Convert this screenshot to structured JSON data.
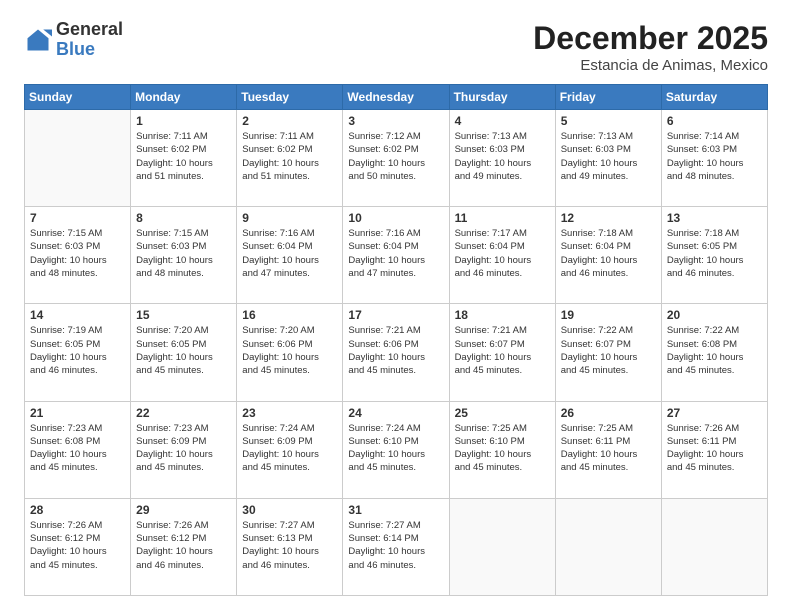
{
  "header": {
    "logo": {
      "general": "General",
      "blue": "Blue"
    },
    "month": "December 2025",
    "location": "Estancia de Animas, Mexico"
  },
  "days_of_week": [
    "Sunday",
    "Monday",
    "Tuesday",
    "Wednesday",
    "Thursday",
    "Friday",
    "Saturday"
  ],
  "weeks": [
    [
      {
        "day": "",
        "info": ""
      },
      {
        "day": "1",
        "info": "Sunrise: 7:11 AM\nSunset: 6:02 PM\nDaylight: 10 hours\nand 51 minutes."
      },
      {
        "day": "2",
        "info": "Sunrise: 7:11 AM\nSunset: 6:02 PM\nDaylight: 10 hours\nand 51 minutes."
      },
      {
        "day": "3",
        "info": "Sunrise: 7:12 AM\nSunset: 6:02 PM\nDaylight: 10 hours\nand 50 minutes."
      },
      {
        "day": "4",
        "info": "Sunrise: 7:13 AM\nSunset: 6:03 PM\nDaylight: 10 hours\nand 49 minutes."
      },
      {
        "day": "5",
        "info": "Sunrise: 7:13 AM\nSunset: 6:03 PM\nDaylight: 10 hours\nand 49 minutes."
      },
      {
        "day": "6",
        "info": "Sunrise: 7:14 AM\nSunset: 6:03 PM\nDaylight: 10 hours\nand 48 minutes."
      }
    ],
    [
      {
        "day": "7",
        "info": "Sunrise: 7:15 AM\nSunset: 6:03 PM\nDaylight: 10 hours\nand 48 minutes."
      },
      {
        "day": "8",
        "info": "Sunrise: 7:15 AM\nSunset: 6:03 PM\nDaylight: 10 hours\nand 48 minutes."
      },
      {
        "day": "9",
        "info": "Sunrise: 7:16 AM\nSunset: 6:04 PM\nDaylight: 10 hours\nand 47 minutes."
      },
      {
        "day": "10",
        "info": "Sunrise: 7:16 AM\nSunset: 6:04 PM\nDaylight: 10 hours\nand 47 minutes."
      },
      {
        "day": "11",
        "info": "Sunrise: 7:17 AM\nSunset: 6:04 PM\nDaylight: 10 hours\nand 46 minutes."
      },
      {
        "day": "12",
        "info": "Sunrise: 7:18 AM\nSunset: 6:04 PM\nDaylight: 10 hours\nand 46 minutes."
      },
      {
        "day": "13",
        "info": "Sunrise: 7:18 AM\nSunset: 6:05 PM\nDaylight: 10 hours\nand 46 minutes."
      }
    ],
    [
      {
        "day": "14",
        "info": "Sunrise: 7:19 AM\nSunset: 6:05 PM\nDaylight: 10 hours\nand 46 minutes."
      },
      {
        "day": "15",
        "info": "Sunrise: 7:20 AM\nSunset: 6:05 PM\nDaylight: 10 hours\nand 45 minutes."
      },
      {
        "day": "16",
        "info": "Sunrise: 7:20 AM\nSunset: 6:06 PM\nDaylight: 10 hours\nand 45 minutes."
      },
      {
        "day": "17",
        "info": "Sunrise: 7:21 AM\nSunset: 6:06 PM\nDaylight: 10 hours\nand 45 minutes."
      },
      {
        "day": "18",
        "info": "Sunrise: 7:21 AM\nSunset: 6:07 PM\nDaylight: 10 hours\nand 45 minutes."
      },
      {
        "day": "19",
        "info": "Sunrise: 7:22 AM\nSunset: 6:07 PM\nDaylight: 10 hours\nand 45 minutes."
      },
      {
        "day": "20",
        "info": "Sunrise: 7:22 AM\nSunset: 6:08 PM\nDaylight: 10 hours\nand 45 minutes."
      }
    ],
    [
      {
        "day": "21",
        "info": "Sunrise: 7:23 AM\nSunset: 6:08 PM\nDaylight: 10 hours\nand 45 minutes."
      },
      {
        "day": "22",
        "info": "Sunrise: 7:23 AM\nSunset: 6:09 PM\nDaylight: 10 hours\nand 45 minutes."
      },
      {
        "day": "23",
        "info": "Sunrise: 7:24 AM\nSunset: 6:09 PM\nDaylight: 10 hours\nand 45 minutes."
      },
      {
        "day": "24",
        "info": "Sunrise: 7:24 AM\nSunset: 6:10 PM\nDaylight: 10 hours\nand 45 minutes."
      },
      {
        "day": "25",
        "info": "Sunrise: 7:25 AM\nSunset: 6:10 PM\nDaylight: 10 hours\nand 45 minutes."
      },
      {
        "day": "26",
        "info": "Sunrise: 7:25 AM\nSunset: 6:11 PM\nDaylight: 10 hours\nand 45 minutes."
      },
      {
        "day": "27",
        "info": "Sunrise: 7:26 AM\nSunset: 6:11 PM\nDaylight: 10 hours\nand 45 minutes."
      }
    ],
    [
      {
        "day": "28",
        "info": "Sunrise: 7:26 AM\nSunset: 6:12 PM\nDaylight: 10 hours\nand 45 minutes."
      },
      {
        "day": "29",
        "info": "Sunrise: 7:26 AM\nSunset: 6:12 PM\nDaylight: 10 hours\nand 46 minutes."
      },
      {
        "day": "30",
        "info": "Sunrise: 7:27 AM\nSunset: 6:13 PM\nDaylight: 10 hours\nand 46 minutes."
      },
      {
        "day": "31",
        "info": "Sunrise: 7:27 AM\nSunset: 6:14 PM\nDaylight: 10 hours\nand 46 minutes."
      },
      {
        "day": "",
        "info": ""
      },
      {
        "day": "",
        "info": ""
      },
      {
        "day": "",
        "info": ""
      }
    ]
  ]
}
